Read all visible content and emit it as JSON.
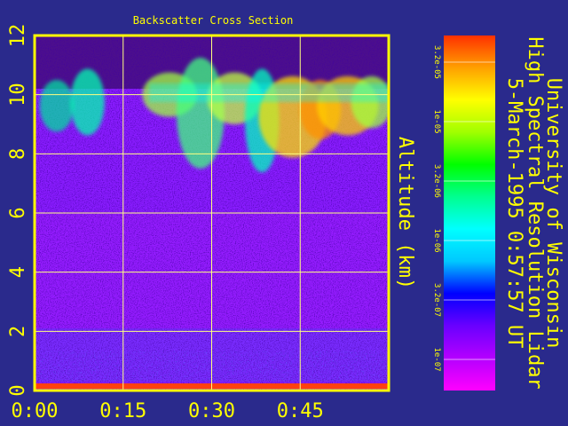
{
  "chart_data": {
    "type": "heatmap",
    "title": "Backscatter Cross Section",
    "ylabel": "Altitude (km)",
    "xlabel": "",
    "ylim": [
      0,
      12
    ],
    "xlim_minutes": [
      0,
      60
    ],
    "y_ticks": [
      "0",
      "2",
      "4",
      "6",
      "8",
      "10",
      "12"
    ],
    "x_ticks": [
      "0:00",
      "0:15",
      "0:30",
      "0:45"
    ],
    "colorbar_ticks": [
      "3.2e-05",
      "1e-05",
      "3.2e-06",
      "1e-06",
      "3.2e-07",
      "1e-07"
    ],
    "colorbar_stops": [
      "#ff00ff",
      "#b400ff",
      "#6a00ff",
      "#0000ff",
      "#00c8ff",
      "#00ffff",
      "#00ff90",
      "#00ff00",
      "#a0ff00",
      "#ffff00",
      "#ffa000",
      "#ff3000"
    ],
    "grid": true,
    "cloud_layer": {
      "altitude_range_km": [
        8,
        10.5
      ],
      "time_range_minutes": [
        2,
        60
      ]
    },
    "colors": {
      "background": "#2a2a8c",
      "frame": "#ffff00",
      "grid": "#ffff80",
      "text": "#ffff00"
    }
  },
  "side_text": {
    "line1": "University of Wisconsin",
    "line2": "High Spectral Resolution Lidar",
    "line3": "5-March-1995   0:57:57 UT"
  }
}
